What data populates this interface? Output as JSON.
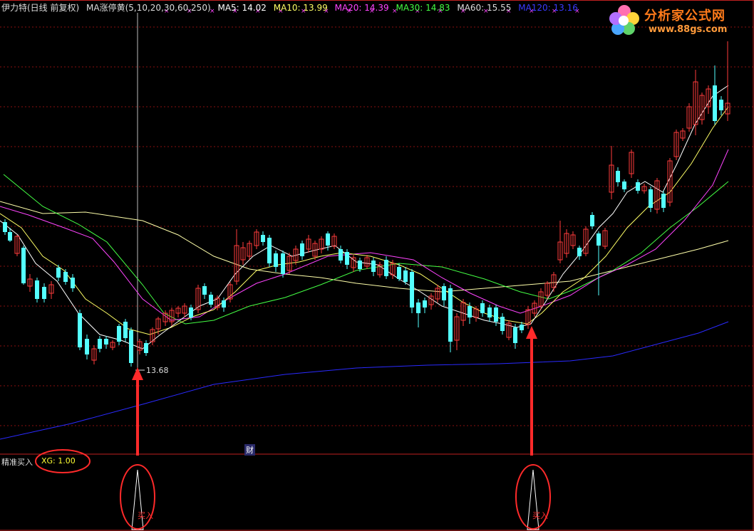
{
  "header": {
    "stock": "伊力特(日线 前复权)",
    "indicator": "MA涨停黄(5,10,20,30,60,250)",
    "ma5": "MA5: 14.02",
    "ma10": "MA10: 13.99",
    "ma20": "MA20: 14.39",
    "ma30": "MA30: 14.83",
    "ma60": "MA60: 15.55",
    "ma120": "MA120: 13.16"
  },
  "colors": {
    "up": "#ff3c3c",
    "down": "#54ffff",
    "ma5": "#ffffff",
    "ma10": "#ffff66",
    "ma20": "#ff44ff",
    "ma30": "#44ff44",
    "ma60": "#ffffaa",
    "ma120": "#2a2aff",
    "grid": "#8a1010",
    "arrow": "#ff2a2a"
  },
  "logo": {
    "title": "分析家公式网",
    "url": "www.88gs.com"
  },
  "low_price_label": "13.68",
  "finance_marker": "财",
  "lower_panel": {
    "name": "精准买入",
    "xg": "XG: 1.00",
    "signal_label": "买入"
  }
}
